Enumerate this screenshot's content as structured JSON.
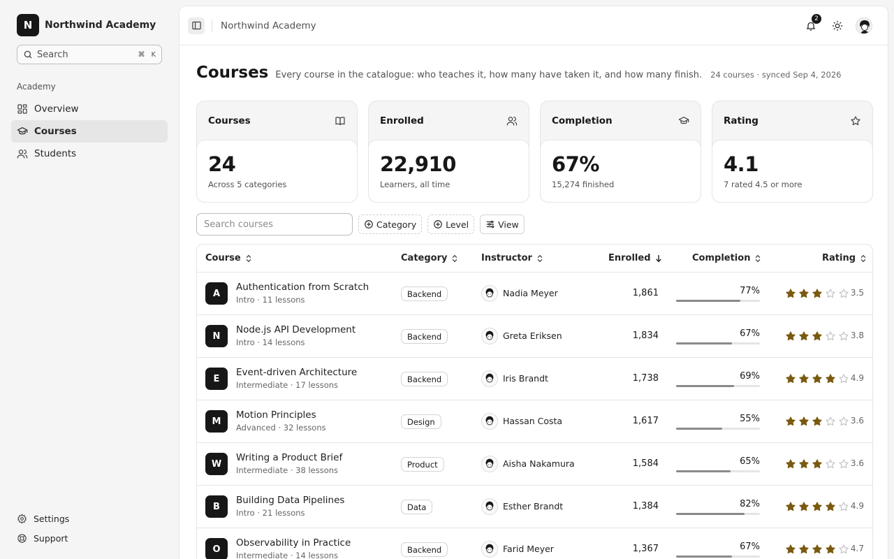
{
  "app": {
    "brand_initial": "N",
    "brand_name": "Northwind Academy",
    "search_label": "Search",
    "search_shortcut": [
      "⌘",
      "K"
    ],
    "group_label": "Academy",
    "nav": [
      {
        "label": "Overview",
        "icon": "grid-icon"
      },
      {
        "label": "Courses",
        "icon": "graduation-cap-icon",
        "active": true
      },
      {
        "label": "Students",
        "icon": "users-icon"
      }
    ],
    "nav_bottom": [
      {
        "label": "Settings",
        "icon": "gear-icon"
      },
      {
        "label": "Support",
        "icon": "lifebuoy-icon"
      }
    ]
  },
  "topbar": {
    "breadcrumb": "Northwind Academy",
    "notification_count": "2"
  },
  "page": {
    "title": "Courses",
    "subtitle": "Every course in the catalogue: who teaches it, how many have taken it, and how many finish.",
    "meta": "24 courses · synced Sep 4, 2026"
  },
  "stats": [
    {
      "title": "Courses",
      "value": "24",
      "note": "Across 5 categories",
      "icon": "book-icon"
    },
    {
      "title": "Enrolled",
      "value": "22,910",
      "note": "Learners, all time",
      "icon": "users-icon"
    },
    {
      "title": "Completion",
      "value": "67%",
      "note": "15,274 finished",
      "icon": "graduation-cap-icon"
    },
    {
      "title": "Rating",
      "value": "4.1",
      "note": "7 rated 4.5 or more",
      "icon": "star-icon"
    }
  ],
  "toolbar": {
    "search_placeholder": "Search courses",
    "category_label": "Category",
    "level_label": "Level",
    "view_label": "View"
  },
  "table": {
    "columns": {
      "course": "Course",
      "category": "Category",
      "instructor": "Instructor",
      "enrolled": "Enrolled",
      "completion": "Completion",
      "rating": "Rating"
    },
    "sorted_by": "enrolled",
    "rows": [
      {
        "initial": "A",
        "name": "Authentication from Scratch",
        "meta": "Intro · 11 lessons",
        "category": "Backend",
        "instructor": "Nadia Meyer",
        "enrolled": "1,861",
        "completion": "77%",
        "completion_value": 77,
        "stars": 3,
        "rating": "3.5"
      },
      {
        "initial": "N",
        "name": "Node.js API Development",
        "meta": "Intro · 14 lessons",
        "category": "Backend",
        "instructor": "Greta Eriksen",
        "enrolled": "1,834",
        "completion": "67%",
        "completion_value": 67,
        "stars": 3,
        "rating": "3.8"
      },
      {
        "initial": "E",
        "name": "Event-driven Architecture",
        "meta": "Intermediate · 17 lessons",
        "category": "Backend",
        "instructor": "Iris Brandt",
        "enrolled": "1,738",
        "completion": "69%",
        "completion_value": 69,
        "stars": 4,
        "rating": "4.9"
      },
      {
        "initial": "M",
        "name": "Motion Principles",
        "meta": "Advanced · 32 lessons",
        "category": "Design",
        "instructor": "Hassan Costa",
        "enrolled": "1,617",
        "completion": "55%",
        "completion_value": 55,
        "stars": 3,
        "rating": "3.6"
      },
      {
        "initial": "W",
        "name": "Writing a Product Brief",
        "meta": "Intermediate · 38 lessons",
        "category": "Product",
        "instructor": "Aisha Nakamura",
        "enrolled": "1,584",
        "completion": "65%",
        "completion_value": 65,
        "stars": 3,
        "rating": "3.6"
      },
      {
        "initial": "B",
        "name": "Building Data Pipelines",
        "meta": "Intro · 21 lessons",
        "category": "Data",
        "instructor": "Esther Brandt",
        "enrolled": "1,384",
        "completion": "82%",
        "completion_value": 82,
        "stars": 4,
        "rating": "4.9"
      },
      {
        "initial": "O",
        "name": "Observability in Practice",
        "meta": "Intermediate · 14 lessons",
        "category": "Backend",
        "instructor": "Farid Meyer",
        "enrolled": "1,367",
        "completion": "67%",
        "completion_value": 67,
        "stars": 4,
        "rating": "4.7"
      }
    ]
  },
  "colors": {
    "star_filled": "#7a5a10",
    "star_empty": "#c4c4c4",
    "dark": "#171717",
    "bar_fill": "#8a8a8a"
  }
}
